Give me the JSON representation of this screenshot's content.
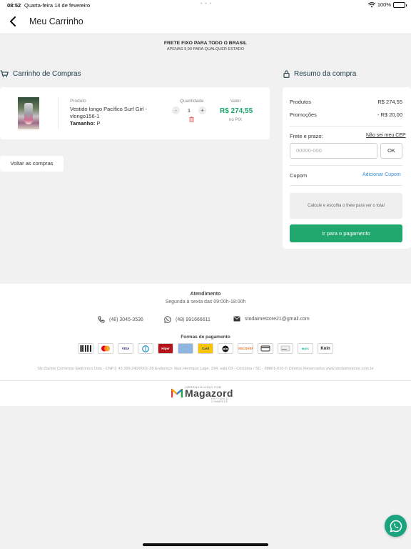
{
  "status": {
    "time": "08:52",
    "date": "Quarta-feira 14 de fevereiro",
    "battery": "100%"
  },
  "nav": {
    "title": "Meu Carrinho",
    "back_icon": "chevron-left-icon"
  },
  "notice": {
    "line1": "FRETE FIXO PARA TODO O BRASIL",
    "line2": "APENAS 9,90 PARA QUALQUER ESTADO"
  },
  "cart": {
    "title": "Carrinho de Compras",
    "col_product": "Produto",
    "col_quantity": "Quantidade",
    "col_value": "Valor",
    "item": {
      "name": "Vestido longo Pacífico Surf Girl - vlongo156-1",
      "size_label": "Tamanho:",
      "size_value": "P",
      "quantity": "1",
      "minus": "-",
      "plus": "+",
      "price": "R$ 274,55",
      "price_note": "no PIX"
    },
    "back_button": "Voltar as compras"
  },
  "summary": {
    "title": "Resumo da compra",
    "products_label": "Produtos",
    "products_value": "R$ 274,55",
    "promo_label": "Promoções",
    "promo_value": "- R$ 20,00",
    "shipping_label": "Frete e prazo:",
    "cep_link": "Não sei meu CEP",
    "cep_placeholder": "00000-000",
    "ok_label": "OK",
    "coupon_label": "Cupom",
    "coupon_link": "Adicionar Cupom",
    "info": "Calcule e escolha o frete para ver o total",
    "pay_button": "Ir para o pagamento"
  },
  "footer": {
    "service_title": "Atendimento",
    "service_hours": "Segunda à sexta das 09:00h-18:00h",
    "phone": "(48) 3045-3536",
    "whatsapp": "(48) 991666611",
    "email": "stodaimestore21@gmail.com",
    "payments_title": "Formas de pagamento",
    "payment_methods": [
      "boleto",
      "mastercard",
      "visa",
      "diners",
      "hipercard",
      "amex",
      "sorocred",
      "elo",
      "discover",
      "cabal",
      "banricompras",
      "pix",
      "koin"
    ],
    "legal": "Sto Daime Comercio Eletronico Ltda - CNPJ: 43.339.240/0001-28 Endereço: Rua Henrique Lage, 234, sala 03 - Criciúma / SC - 88801-010 © Direitos Reservados www.stodaimestore.com.br",
    "dev_label": "DESENVOLVIDO POR",
    "brand": "Magazord",
    "brand_sub": "ERP PARA E-COMMERCE"
  },
  "colors": {
    "accent": "#20a86f",
    "price": "#1aa86a",
    "link": "#3a8fd6",
    "title": "#1e3d4a"
  }
}
